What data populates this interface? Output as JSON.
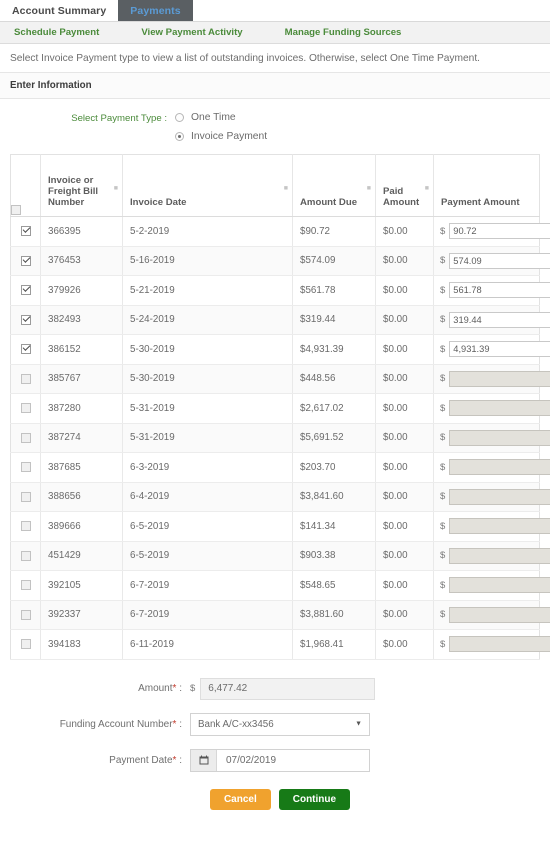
{
  "tabs": [
    {
      "label": "Account Summary",
      "active": false
    },
    {
      "label": "Payments",
      "active": true
    }
  ],
  "subnav": [
    {
      "label": "Schedule Payment"
    },
    {
      "label": "View Payment Activity"
    },
    {
      "label": "Manage Funding Sources"
    }
  ],
  "instruction": "Select Invoice Payment type to view a list of outstanding invoices. Otherwise, select One Time Payment.",
  "section_title": "Enter Information",
  "payment_type": {
    "label": "Select Payment Type :",
    "options": [
      {
        "label": "One Time",
        "selected": false
      },
      {
        "label": "Invoice Payment",
        "selected": true
      }
    ]
  },
  "table": {
    "headers": {
      "select_all": "",
      "invoice_number": "Invoice or Freight Bill Number",
      "invoice_date": "Invoice Date",
      "amount_due": "Amount Due",
      "paid_amount": "Paid Amount",
      "payment_amount": "Payment Amount"
    },
    "currency_symbol": "$",
    "rows": [
      {
        "checked": true,
        "number": "366395",
        "date": "5-2-2019",
        "amount_due": "$90.72",
        "paid_amount": "$0.00",
        "payment_amount": "90.72"
      },
      {
        "checked": true,
        "number": "376453",
        "date": "5-16-2019",
        "amount_due": "$574.09",
        "paid_amount": "$0.00",
        "payment_amount": "574.09"
      },
      {
        "checked": true,
        "number": "379926",
        "date": "5-21-2019",
        "amount_due": "$561.78",
        "paid_amount": "$0.00",
        "payment_amount": "561.78"
      },
      {
        "checked": true,
        "number": "382493",
        "date": "5-24-2019",
        "amount_due": "$319.44",
        "paid_amount": "$0.00",
        "payment_amount": "319.44"
      },
      {
        "checked": true,
        "number": "386152",
        "date": "5-30-2019",
        "amount_due": "$4,931.39",
        "paid_amount": "$0.00",
        "payment_amount": "4,931.39"
      },
      {
        "checked": false,
        "number": "385767",
        "date": "5-30-2019",
        "amount_due": "$448.56",
        "paid_amount": "$0.00",
        "payment_amount": ""
      },
      {
        "checked": false,
        "number": "387280",
        "date": "5-31-2019",
        "amount_due": "$2,617.02",
        "paid_amount": "$0.00",
        "payment_amount": ""
      },
      {
        "checked": false,
        "number": "387274",
        "date": "5-31-2019",
        "amount_due": "$5,691.52",
        "paid_amount": "$0.00",
        "payment_amount": ""
      },
      {
        "checked": false,
        "number": "387685",
        "date": "6-3-2019",
        "amount_due": "$203.70",
        "paid_amount": "$0.00",
        "payment_amount": ""
      },
      {
        "checked": false,
        "number": "388656",
        "date": "6-4-2019",
        "amount_due": "$3,841.60",
        "paid_amount": "$0.00",
        "payment_amount": ""
      },
      {
        "checked": false,
        "number": "389666",
        "date": "6-5-2019",
        "amount_due": "$141.34",
        "paid_amount": "$0.00",
        "payment_amount": ""
      },
      {
        "checked": false,
        "number": "451429",
        "date": "6-5-2019",
        "amount_due": "$903.38",
        "paid_amount": "$0.00",
        "payment_amount": ""
      },
      {
        "checked": false,
        "number": "392105",
        "date": "6-7-2019",
        "amount_due": "$548.65",
        "paid_amount": "$0.00",
        "payment_amount": ""
      },
      {
        "checked": false,
        "number": "392337",
        "date": "6-7-2019",
        "amount_due": "$3,881.60",
        "paid_amount": "$0.00",
        "payment_amount": ""
      },
      {
        "checked": false,
        "number": "394183",
        "date": "6-11-2019",
        "amount_due": "$1,968.41",
        "paid_amount": "$0.00",
        "payment_amount": ""
      }
    ]
  },
  "form": {
    "amount": {
      "label": "Amount",
      "required_mark": "*",
      "suffix": " :",
      "currency_symbol": "$",
      "value": "6,477.42"
    },
    "funding_account": {
      "label": "Funding Account Number",
      "required_mark": "*",
      "suffix": " :",
      "value": "Bank A/C-xx3456",
      "caret": "▼"
    },
    "payment_date": {
      "label": "Payment Date",
      "required_mark": "*",
      "suffix": " :",
      "value": "07/02/2019",
      "calendar_icon": "Ὄ5"
    }
  },
  "buttons": {
    "cancel": "Cancel",
    "continue": "Continue"
  },
  "colors": {
    "active_tab_bg": "#5a5f63",
    "active_tab_text": "#5b9bd5",
    "subnav_link": "#4b8b3b",
    "cancel": "#f0a22e",
    "continue": "#177a17"
  }
}
